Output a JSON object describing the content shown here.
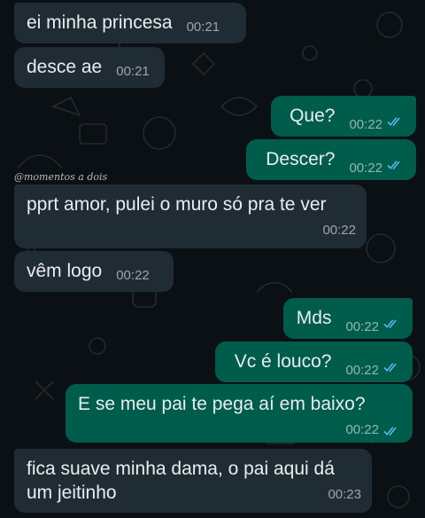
{
  "watermark": "@momentos a dois",
  "colors": {
    "background": "#0b1014",
    "incoming_bubble": "#202c33",
    "outgoing_bubble": "#005c4b",
    "read_ticks": "#53bdeb"
  },
  "messages": [
    {
      "direction": "incoming",
      "text": "ei minha princesa",
      "time": "00:21"
    },
    {
      "direction": "incoming",
      "text": "desce ae",
      "time": "00:21"
    },
    {
      "direction": "outgoing",
      "text": "Que?",
      "time": "00:22",
      "status": "read"
    },
    {
      "direction": "outgoing",
      "text": "Descer?",
      "time": "00:22",
      "status": "read"
    },
    {
      "direction": "incoming",
      "text": "pprt amor, pulei o muro só pra te ver",
      "time": "00:22"
    },
    {
      "direction": "incoming",
      "text": "vêm logo",
      "time": "00:22"
    },
    {
      "direction": "outgoing",
      "text": "Mds",
      "time": "00:22",
      "status": "read"
    },
    {
      "direction": "outgoing",
      "text": "Vc é louco?",
      "time": "00:22",
      "status": "read"
    },
    {
      "direction": "outgoing",
      "text": "E se meu pai te pega aí em baixo?",
      "time": "00:22",
      "status": "read"
    },
    {
      "direction": "incoming",
      "text": "fica suave minha dama, o pai aqui dá um jeitinho",
      "time": "00:23"
    }
  ]
}
